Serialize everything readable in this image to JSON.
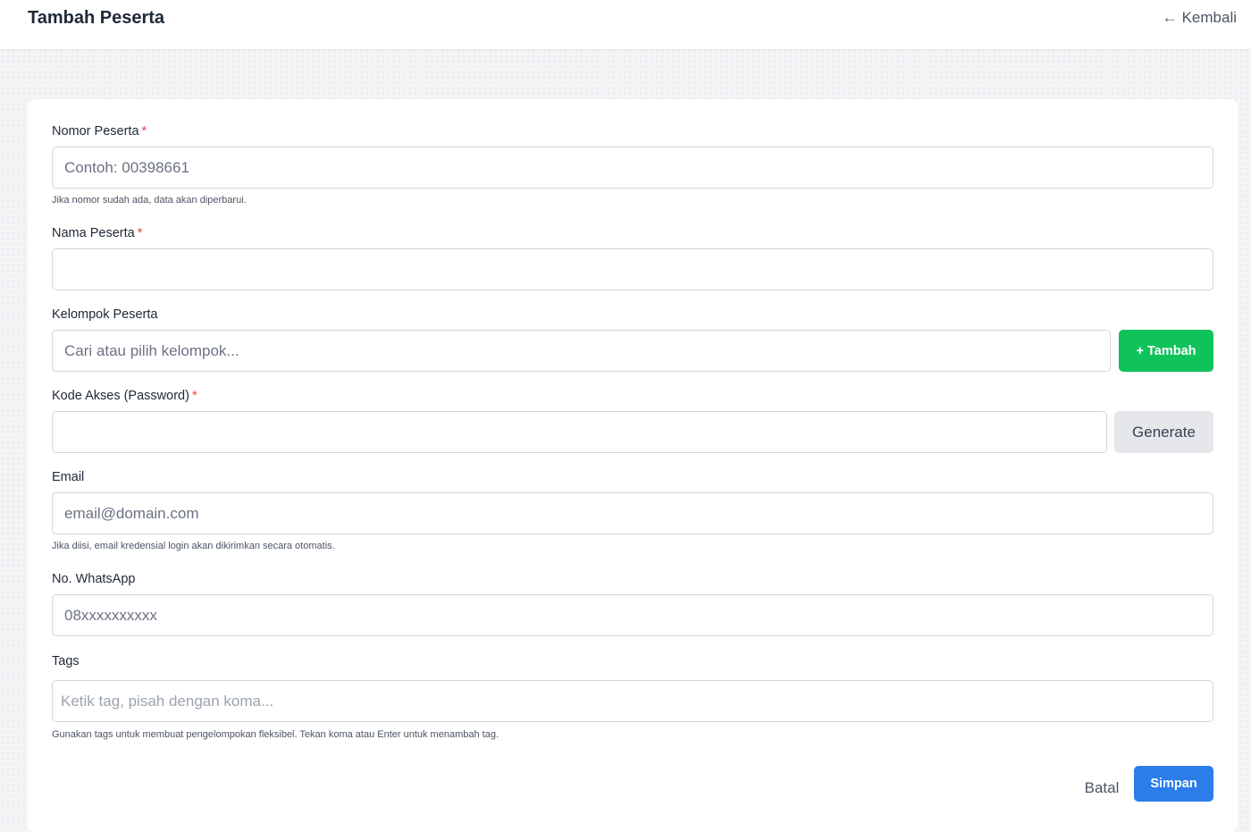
{
  "header": {
    "title": "Tambah Peserta",
    "back_icon": "arrow-left-icon",
    "back_label": "Kembali"
  },
  "form": {
    "nomor": {
      "label": "Nomor Peserta",
      "required_mark": "*",
      "placeholder": "Contoh: 00398661",
      "value": "",
      "hint": "Jika nomor sudah ada, data akan diperbarui."
    },
    "nama": {
      "label": "Nama Peserta",
      "required_mark": "*",
      "placeholder": "",
      "value": ""
    },
    "kelompok": {
      "label": "Kelompok Peserta",
      "placeholder": "Cari atau pilih kelompok...",
      "value": "",
      "add_button_label": "+ Tambah"
    },
    "kode_akses": {
      "label": "Kode Akses (Password)",
      "required_mark": "*",
      "placeholder": "",
      "value": "",
      "generate_button_label": "Generate"
    },
    "email": {
      "label": "Email",
      "placeholder": "email@domain.com",
      "value": "",
      "hint": "Jika diisi, email kredensial login akan dikirimkan secara otomatis."
    },
    "whatsapp": {
      "label": "No. WhatsApp",
      "placeholder": "08xxxxxxxxxx",
      "value": ""
    },
    "tags": {
      "label": "Tags",
      "placeholder": "Ketik tag, pisah dengan koma...",
      "value": "",
      "hint": "Gunakan tags untuk membuat pengelompokan fleksibel. Tekan koma atau Enter untuk menambah tag."
    }
  },
  "actions": {
    "cancel_label": "Batal",
    "submit_label": "Simpan"
  },
  "colors": {
    "primary": "#2b7de9",
    "success": "#10c25a",
    "required": "#ef4444"
  }
}
